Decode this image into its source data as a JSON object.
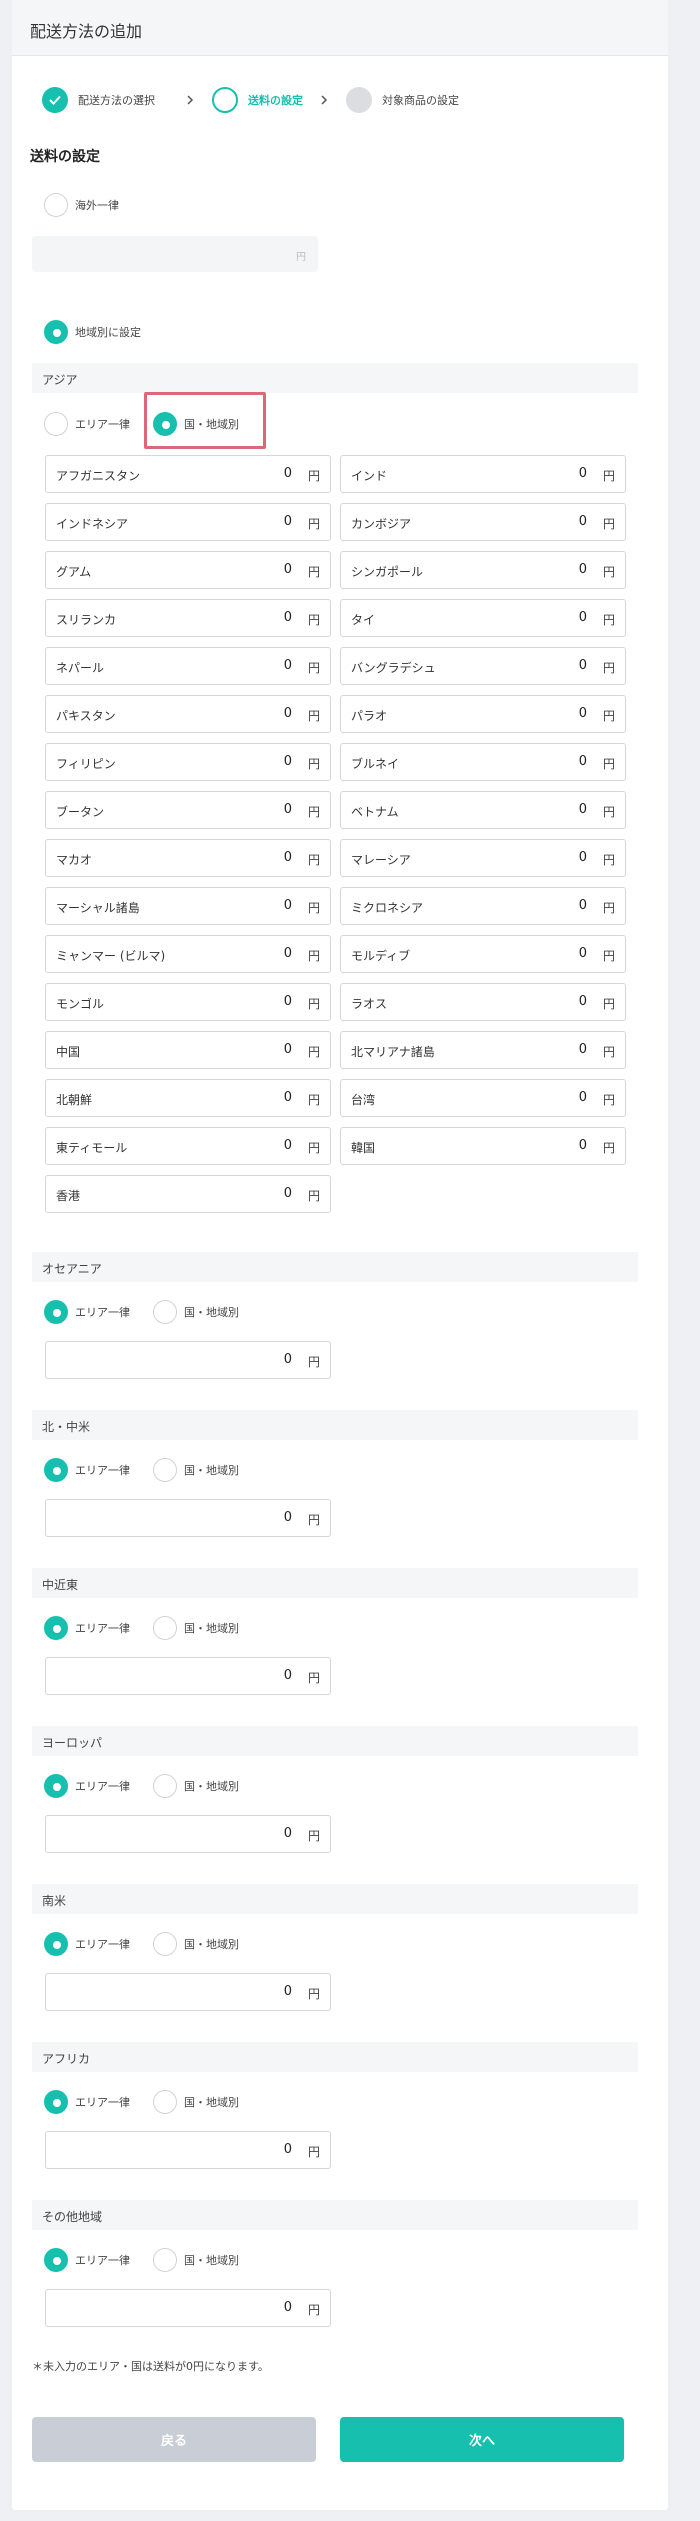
{
  "page_title": "配送方法の追加",
  "accent_color": "#17bfae",
  "steps": [
    {
      "label": "配送方法の選択",
      "state": "done"
    },
    {
      "label": "送料の設定",
      "state": "current"
    },
    {
      "label": "対象商品の設定",
      "state": "todo"
    }
  ],
  "section_title": "送料の設定",
  "mode": {
    "flat_label": "海外一律",
    "flat_selected": false,
    "flat_unit": "円",
    "by_region_label": "地域別に設定",
    "by_region_selected": true
  },
  "radio_labels": {
    "area": "エリア一律",
    "country": "国・地域別"
  },
  "asia": {
    "name": "アジア",
    "selected": "country",
    "countries": [
      {
        "name": "アフガニスタン",
        "value": "0",
        "unit": "円"
      },
      {
        "name": "インド",
        "value": "0",
        "unit": "円"
      },
      {
        "name": "インドネシア",
        "value": "0",
        "unit": "円"
      },
      {
        "name": "カンボジア",
        "value": "0",
        "unit": "円"
      },
      {
        "name": "グアム",
        "value": "0",
        "unit": "円"
      },
      {
        "name": "シンガポール",
        "value": "0",
        "unit": "円"
      },
      {
        "name": "スリランカ",
        "value": "0",
        "unit": "円"
      },
      {
        "name": "タイ",
        "value": "0",
        "unit": "円"
      },
      {
        "name": "ネパール",
        "value": "0",
        "unit": "円"
      },
      {
        "name": "バングラデシュ",
        "value": "0",
        "unit": "円"
      },
      {
        "name": "パキスタン",
        "value": "0",
        "unit": "円"
      },
      {
        "name": "パラオ",
        "value": "0",
        "unit": "円"
      },
      {
        "name": "フィリピン",
        "value": "0",
        "unit": "円"
      },
      {
        "name": "ブルネイ",
        "value": "0",
        "unit": "円"
      },
      {
        "name": "ブータン",
        "value": "0",
        "unit": "円"
      },
      {
        "name": "ベトナム",
        "value": "0",
        "unit": "円"
      },
      {
        "name": "マカオ",
        "value": "0",
        "unit": "円"
      },
      {
        "name": "マレーシア",
        "value": "0",
        "unit": "円"
      },
      {
        "name": "マーシャル諸島",
        "value": "0",
        "unit": "円"
      },
      {
        "name": "ミクロネシア",
        "value": "0",
        "unit": "円"
      },
      {
        "name": "ミャンマー (ビルマ)",
        "value": "0",
        "unit": "円"
      },
      {
        "name": "モルディブ",
        "value": "0",
        "unit": "円"
      },
      {
        "name": "モンゴル",
        "value": "0",
        "unit": "円"
      },
      {
        "name": "ラオス",
        "value": "0",
        "unit": "円"
      },
      {
        "name": "中国",
        "value": "0",
        "unit": "円"
      },
      {
        "name": "北マリアナ諸島",
        "value": "0",
        "unit": "円"
      },
      {
        "name": "北朝鮮",
        "value": "0",
        "unit": "円"
      },
      {
        "name": "台湾",
        "value": "0",
        "unit": "円"
      },
      {
        "name": "東ティモール",
        "value": "0",
        "unit": "円"
      },
      {
        "name": "韓国",
        "value": "0",
        "unit": "円"
      },
      {
        "name": "香港",
        "value": "0",
        "unit": "円"
      }
    ]
  },
  "regions": [
    {
      "name": "オセアニア",
      "selected": "area",
      "value": "0",
      "unit": "円"
    },
    {
      "name": "北・中米",
      "selected": "area",
      "value": "0",
      "unit": "円"
    },
    {
      "name": "中近東",
      "selected": "area",
      "value": "0",
      "unit": "円"
    },
    {
      "name": "ヨーロッパ",
      "selected": "area",
      "value": "0",
      "unit": "円"
    },
    {
      "name": "南米",
      "selected": "area",
      "value": "0",
      "unit": "円"
    },
    {
      "name": "アフリカ",
      "selected": "area",
      "value": "0",
      "unit": "円"
    },
    {
      "name": "その他地域",
      "selected": "area",
      "value": "0",
      "unit": "円"
    }
  ],
  "note": "＊未入力のエリア・国は送料が0円になります。",
  "buttons": {
    "back": "戻る",
    "next": "次へ"
  }
}
